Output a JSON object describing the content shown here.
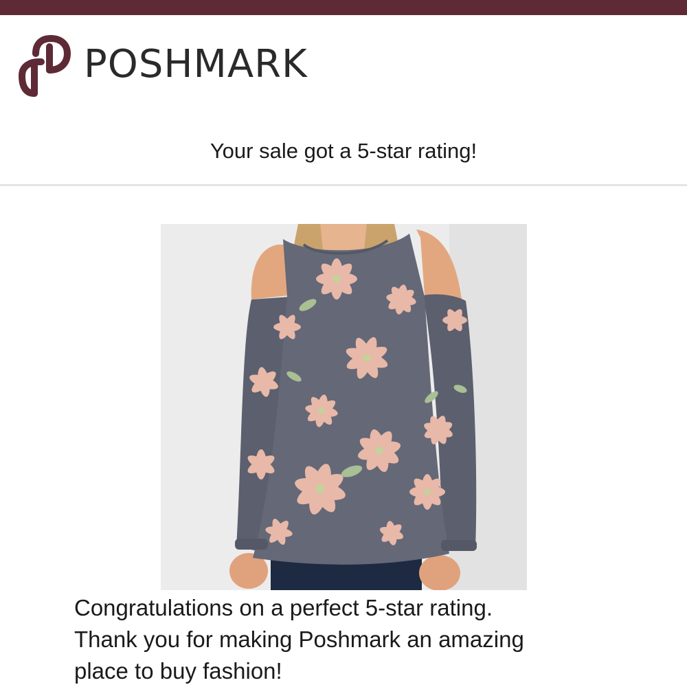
{
  "brand": {
    "name": "POSHMARK",
    "color": "#5e2a36"
  },
  "email": {
    "subject": "Your sale got a 5-star rating!",
    "message_lines": [
      "Congratulations on a perfect 5-star rating.",
      "Thank you for making Poshmark an amazing",
      "place to buy fashion!"
    ]
  },
  "product": {
    "image_icon": "floral-cold-shoulder-top-photo"
  }
}
